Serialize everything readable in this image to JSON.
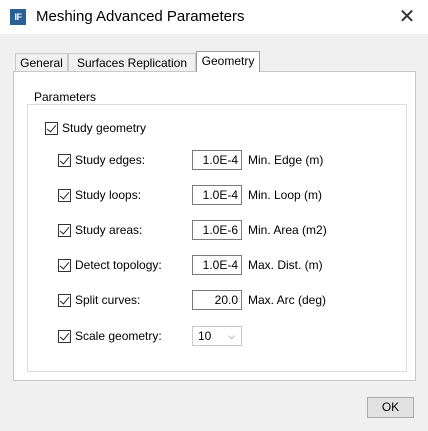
{
  "window": {
    "title": "Meshing Advanced Parameters",
    "icon": "IF"
  },
  "tabs": [
    {
      "label": "General"
    },
    {
      "label": "Surfaces Replication"
    },
    {
      "label": "Geometry"
    }
  ],
  "group": {
    "label": "Parameters"
  },
  "study_geometry": {
    "label": "Study geometry",
    "checked": true
  },
  "rows": [
    {
      "label": "Study edges:",
      "value": "1.0E-4",
      "unit": "Min. Edge (m)",
      "checked": true
    },
    {
      "label": "Study loops:",
      "value": "1.0E-4",
      "unit": "Min. Loop (m)",
      "checked": true
    },
    {
      "label": "Study areas:",
      "value": "1.0E-6",
      "unit": "Min. Area (m2)",
      "checked": true
    },
    {
      "label": "Detect topology:",
      "value": "1.0E-4",
      "unit": "Max. Dist. (m)",
      "checked": true
    },
    {
      "label": "Split curves:",
      "value": "20.0",
      "unit": "Max. Arc (deg)",
      "checked": true
    }
  ],
  "scale_geometry": {
    "label": "Scale geometry:",
    "value": "10",
    "checked": true
  },
  "ok_label": "OK",
  "icons": {
    "app": "app-logo-icon",
    "close": "close-icon",
    "dropdown": "chevron-down-icon",
    "check": "checkmark-icon"
  }
}
